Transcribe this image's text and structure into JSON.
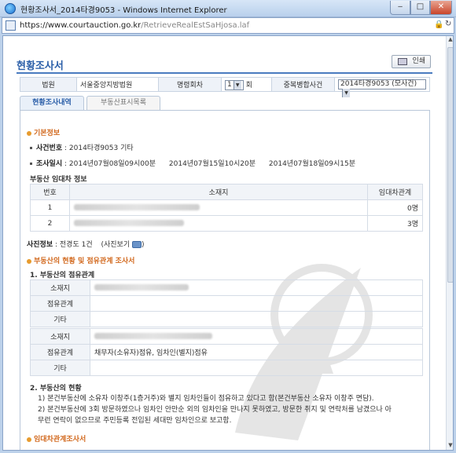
{
  "window": {
    "title": "현황조사서_2014타경9053 - Windows Internet Explorer",
    "controls": {
      "minimize": "‒",
      "maximize": "□",
      "close": "✕"
    }
  },
  "address": {
    "url_main": "https://www.courtauction.go.kr",
    "url_path": "/RetrieveRealEstSaHjosa.laf"
  },
  "page": {
    "title": "현황조사서",
    "print_label": "인쇄"
  },
  "info_table": {
    "court_label": "법원",
    "court_value": "서울중앙지방법원",
    "order_label": "명령회차",
    "order_value": "1",
    "order_unit": "회",
    "case_label": "중복병합사건",
    "case_value": "2014타경9053 (모사건)"
  },
  "tabs": [
    {
      "label": "현황조사내역"
    },
    {
      "label": "부동산표시목록"
    }
  ],
  "basic": {
    "section_title": "기본정보",
    "case_no_label": "사건번호",
    "case_no_value": "2014타경9053 기타",
    "survey_label": "조사일시",
    "survey_dates": [
      "2014년07월08일09시00분",
      "2014년07월15일10시20분",
      "2014년07월18일09시15분"
    ]
  },
  "lease_info": {
    "heading": "부동산 임대차 정보",
    "columns": [
      "번호",
      "소재지",
      "임대차관계"
    ],
    "rows": [
      {
        "no": "1",
        "count": "0명"
      },
      {
        "no": "2",
        "count": "3명"
      }
    ]
  },
  "photo": {
    "label": "사진정보",
    "value": "전경도 1건",
    "view_label": "(사진보기"
  },
  "status": {
    "section_title": "부동산의 현황 및 점유관계 조사서",
    "sub1_title": "1. 부동산의 점유관계",
    "table1": {
      "location": "소재지",
      "occupancy": "점유관계",
      "other": "기타"
    },
    "table2": {
      "location": "소재지",
      "occupancy": "점유관계",
      "occupancy_value": "채무자(소유자)점유, 임차인(별지)점유",
      "other": "기타"
    },
    "sub2_title": "2. 부동산의 현황",
    "note1": "1) 본건부동산에 소유자 이창주(1층거주)와 별지 임차인들이 점유하고 있다고 함(본건부동산 소유자 이창주 면담).",
    "note2a": "2) 본건부동산에 3회 방문하였으나 임차인 안만순 외의 임차인을 만나지 못하였고, 방문한 취지 및 연락처를 남겼으나 아",
    "note2b": "무런 연락이 없으므로 주민등록 전입된 세대만 임차인으로 보고함."
  },
  "lease_section": {
    "title": "임대차관계조사서"
  },
  "colors": {
    "accent": "#2a5ea8",
    "section": "#d2691e"
  }
}
